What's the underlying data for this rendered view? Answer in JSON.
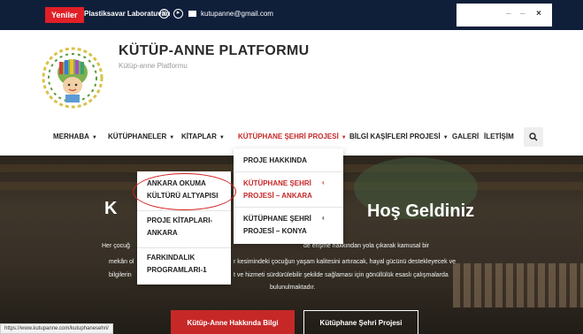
{
  "topbar": {
    "badge": "Yeniler",
    "lab": "Plastiksavar Laboratuvarı",
    "email": "kutupanne@gmail.com",
    "win_min": "–",
    "win_max": "–",
    "win_close": "×"
  },
  "brand": {
    "title": "KÜTÜP-ANNE PLATFORMU",
    "subtitle": "Kütüp-anne Platformu"
  },
  "nav": {
    "items": [
      {
        "label": "MERHABA"
      },
      {
        "label": "KÜTÜPHANELER"
      },
      {
        "label": "KİTAPLAR"
      },
      {
        "label": "KÜTÜPHANE ŞEHRİ PROJESİ"
      },
      {
        "label": "BİLGİ KAŞİFLERİ PROJESİ"
      },
      {
        "label": "GALERİ"
      },
      {
        "label": "İLETİŞİM"
      }
    ],
    "chevron": "▼",
    "search_icon": "search-icon"
  },
  "dropdown_main": {
    "items": [
      {
        "label": "PROJE HAKKINDA"
      },
      {
        "line1": "KÜTÜPHANE ŞEHRİ",
        "line2": "PROJESİ – ANKARA"
      },
      {
        "line1": "KÜTÜPHANE ŞEHRİ",
        "line2": "PROJESİ – KONYA"
      }
    ],
    "arrow": "‹"
  },
  "dropdown_sub": {
    "items": [
      {
        "line1": "ANKARA OKUMA",
        "line2": "KÜLTÜRÜ ALTYAPISI"
      },
      {
        "line1": "PROJE KİTAPLARI-",
        "line2": "ANKARA"
      },
      {
        "line1": "FARKINDALIK",
        "line2": "PROGRAMLARI-1"
      }
    ]
  },
  "hero": {
    "heading_left": "K",
    "heading_right": "Hoş Geldiniz",
    "p1_left": "Her çocuğ",
    "p1_right": "de erişme hakkından yola çıkarak kamusal bir",
    "p2_left": "mekân ol",
    "p2_right": "r kesimindeki çocuğun yaşam kalitesini artıracak, hayal gücünü destekleyecek ve",
    "p3_left": "bilgilerin",
    "p3_right": "t ve hizmeti sürdürülebilir şekilde sağlaması için gönüllülük esaslı çalışmalarda",
    "p4": "bulunulmaktadır.",
    "btn_primary": "Kütüp-Anne Hakkında Bilgi",
    "btn_secondary": "Kütüphane Şehri Projesi"
  },
  "status_url": "https://www.kutupanne.com/kutuphanesehri/",
  "colors": {
    "topbar": "#0f1f3a",
    "accent_red": "#c62828",
    "badge_red": "#e01f26"
  }
}
